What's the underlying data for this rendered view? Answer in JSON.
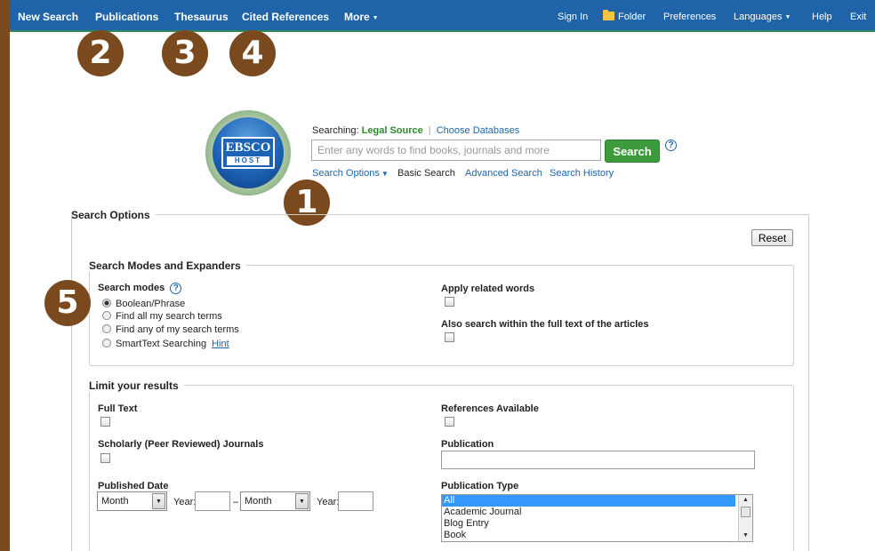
{
  "nav": {
    "left": [
      "New Search",
      "Publications",
      "Thesaurus",
      "Cited References",
      "More"
    ],
    "right": [
      "Sign In",
      "Folder",
      "Preferences",
      "Languages",
      "Help",
      "Exit"
    ]
  },
  "badges": [
    "1",
    "2",
    "3",
    "4",
    "5"
  ],
  "logo": {
    "line1": "EBSCO",
    "line2": "HOST"
  },
  "search": {
    "searching_label": "Searching:",
    "database": "Legal Source",
    "choose_databases": "Choose Databases",
    "placeholder": "Enter any words to find books, journals and more",
    "button": "Search",
    "help": "?"
  },
  "sublinks": {
    "search_options": "Search Options",
    "basic_search": "Basic Search",
    "advanced_search": "Advanced Search",
    "search_history": "Search History"
  },
  "options": {
    "title": "Search Options",
    "reset": "Reset",
    "modes_title": "Search Modes and Expanders",
    "modes_label": "Search modes",
    "modes": [
      "Boolean/Phrase",
      "Find all my search terms",
      "Find any of my search terms",
      "SmartText Searching"
    ],
    "hint": "Hint",
    "apply_related": "Apply related words",
    "also_search": "Also search within the full text of the articles"
  },
  "limits": {
    "title": "Limit your results",
    "full_text": "Full Text",
    "references": "References Available",
    "scholarly": "Scholarly (Peer Reviewed) Journals",
    "publication": "Publication",
    "published_date": "Published Date",
    "month": "Month",
    "year": "Year:",
    "dash": "–",
    "publication_type": "Publication Type",
    "types": [
      "All",
      "Academic Journal",
      "Blog Entry",
      "Book"
    ]
  }
}
